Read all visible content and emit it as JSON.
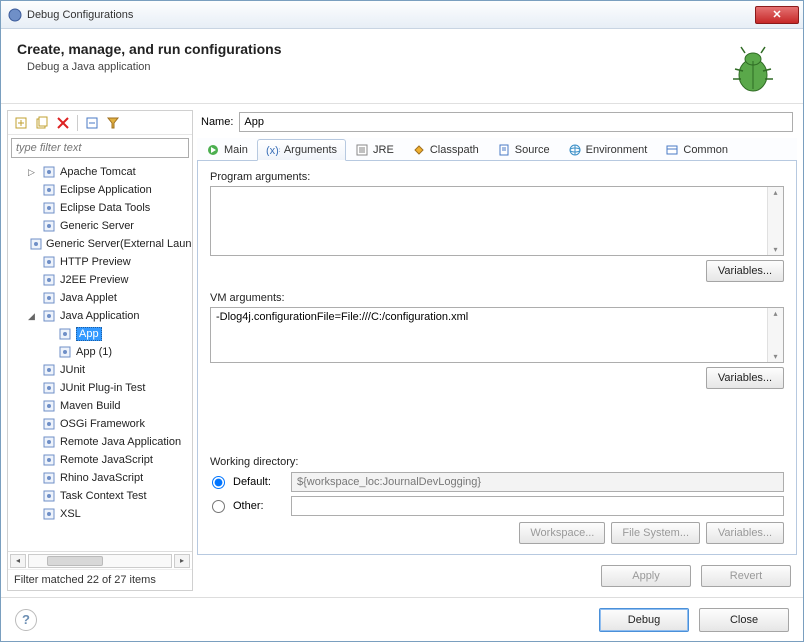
{
  "window": {
    "title": "Debug Configurations"
  },
  "header": {
    "title": "Create, manage, and run configurations",
    "subtitle": "Debug a Java application"
  },
  "filter": {
    "placeholder": "type filter text"
  },
  "tree": [
    {
      "label": "Apache Tomcat",
      "level": 1,
      "expander": "▷"
    },
    {
      "label": "Eclipse Application",
      "level": 1
    },
    {
      "label": "Eclipse Data Tools",
      "level": 1
    },
    {
      "label": "Generic Server",
      "level": 1
    },
    {
      "label": "Generic Server(External Launch)",
      "level": 1
    },
    {
      "label": "HTTP Preview",
      "level": 1
    },
    {
      "label": "J2EE Preview",
      "level": 1
    },
    {
      "label": "Java Applet",
      "level": 1
    },
    {
      "label": "Java Application",
      "level": 1,
      "expander": "◢"
    },
    {
      "label": "App",
      "level": 2,
      "selected": true
    },
    {
      "label": "App (1)",
      "level": 2
    },
    {
      "label": "JUnit",
      "level": 1
    },
    {
      "label": "JUnit Plug-in Test",
      "level": 1
    },
    {
      "label": "Maven Build",
      "level": 1
    },
    {
      "label": "OSGi Framework",
      "level": 1
    },
    {
      "label": "Remote Java Application",
      "level": 1
    },
    {
      "label": "Remote JavaScript",
      "level": 1
    },
    {
      "label": "Rhino JavaScript",
      "level": 1
    },
    {
      "label": "Task Context Test",
      "level": 1
    },
    {
      "label": "XSL",
      "level": 1
    }
  ],
  "status": "Filter matched 22 of 27 items",
  "name": {
    "label": "Name:",
    "value": "App"
  },
  "tabs": {
    "main": "Main",
    "arguments": "Arguments",
    "jre": "JRE",
    "classpath": "Classpath",
    "source": "Source",
    "environment": "Environment",
    "common": "Common"
  },
  "args": {
    "program_label": "Program arguments:",
    "program_value": "",
    "vm_label": "VM arguments:",
    "vm_value": "-Dlog4j.configurationFile=File:///C:/configuration.xml",
    "variables_btn": "Variables..."
  },
  "workdir": {
    "label": "Working directory:",
    "default_label": "Default:",
    "default_value": "${workspace_loc:JournalDevLogging}",
    "other_label": "Other:",
    "other_value": "",
    "workspace_btn": "Workspace...",
    "filesystem_btn": "File System...",
    "variables_btn": "Variables..."
  },
  "actions": {
    "apply": "Apply",
    "revert": "Revert"
  },
  "footer": {
    "debug": "Debug",
    "close": "Close"
  }
}
